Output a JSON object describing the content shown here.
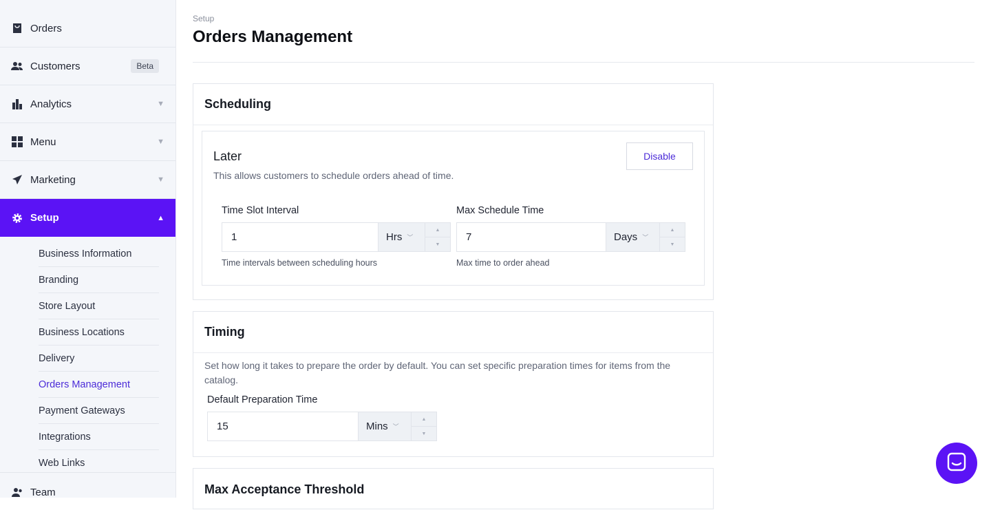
{
  "sidebar": {
    "items": [
      {
        "label": "Orders",
        "icon": "bag-icon"
      },
      {
        "label": "Customers",
        "icon": "users-icon",
        "badge": "Beta"
      },
      {
        "label": "Analytics",
        "icon": "bar-chart-icon"
      },
      {
        "label": "Menu",
        "icon": "grid-icon"
      },
      {
        "label": "Marketing",
        "icon": "paper-plane-icon"
      },
      {
        "label": "Setup",
        "icon": "gear-icon"
      }
    ],
    "submenu": [
      "Business Information",
      "Branding",
      "Store Layout",
      "Business Locations",
      "Delivery",
      "Orders Management",
      "Payment Gateways",
      "Integrations",
      "Web Links"
    ],
    "team_label": "Team",
    "active_color": "#5b13f5"
  },
  "header": {
    "breadcrumb": "Setup",
    "title": "Orders Management"
  },
  "scheduling": {
    "title": "Scheduling",
    "later": {
      "title": "Later",
      "description": "This allows customers to schedule orders ahead of time.",
      "disable_label": "Disable",
      "time_slot": {
        "label": "Time Slot Interval",
        "value": "1",
        "unit": "Hrs",
        "help": "Time intervals between scheduling hours"
      },
      "max_schedule": {
        "label": "Max Schedule Time",
        "value": "7",
        "unit": "Days",
        "help": "Max time to order ahead"
      }
    }
  },
  "timing": {
    "title": "Timing",
    "description": "Set how long it takes to prepare the order by default. You can set specific preparation times for items from the catalog.",
    "prep": {
      "label": "Default Preparation Time",
      "value": "15",
      "unit": "Mins"
    }
  },
  "threshold": {
    "title": "Max Acceptance Threshold"
  }
}
